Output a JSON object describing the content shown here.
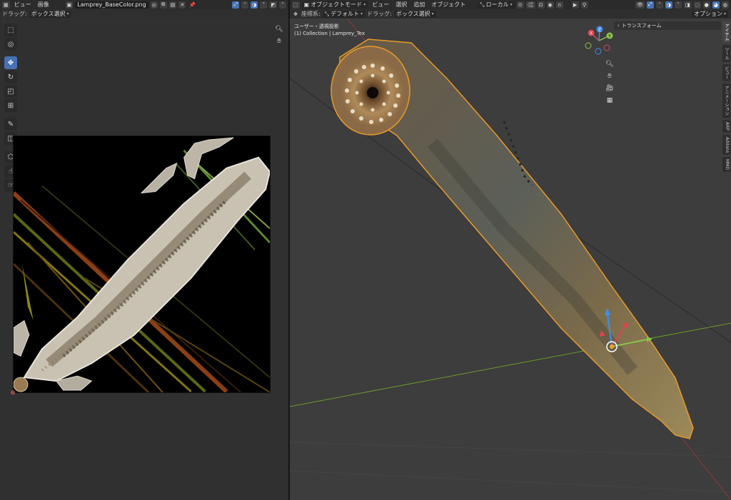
{
  "uv_editor": {
    "header": {
      "editor_type_icon": "image-editor-icon",
      "menus": [
        "ビュー",
        "画像"
      ],
      "image_name": "Lamprey_BaseColor.png"
    },
    "subheader": {
      "drag_label": "ドラッグ:",
      "drag_value": "ボックス選択"
    },
    "tools": [
      "select-box-icon",
      "cursor-icon",
      "move-icon",
      "rotate-icon",
      "scale-icon",
      "transform-icon",
      "annotate-icon",
      "rip-icon",
      "grab-icon",
      "relax-icon",
      "pinch-icon"
    ]
  },
  "viewport": {
    "header": {
      "mode": "オブジェクトモード",
      "menus": [
        "ビュー",
        "選択",
        "追加",
        "オブジェクト"
      ],
      "transform_orientation": "ローカル"
    },
    "subheader": {
      "coord_label": "座標系:",
      "coord_value": "デフォルト",
      "drag_label": "ドラッグ:",
      "drag_value": "ボックス選択",
      "options": "オプション"
    },
    "overlay": {
      "view_name": "ユーザー・透視投影",
      "collection": "(1) Collection | Lamprey_Tex"
    },
    "n_panel": {
      "section": "トランスフォーム"
    },
    "side_tabs": [
      "アイテム",
      "ツール",
      "ビュー",
      "アニメーション",
      "ARP",
      "Addons",
      "MMD"
    ],
    "gizmo_axes": [
      "X",
      "Y",
      "Z"
    ]
  },
  "colors": {
    "accent": "#4772b3",
    "x_axis": "#e04452",
    "y_axis": "#8bc34a",
    "z_axis": "#3d8ff1",
    "selection": "#f0a030"
  }
}
